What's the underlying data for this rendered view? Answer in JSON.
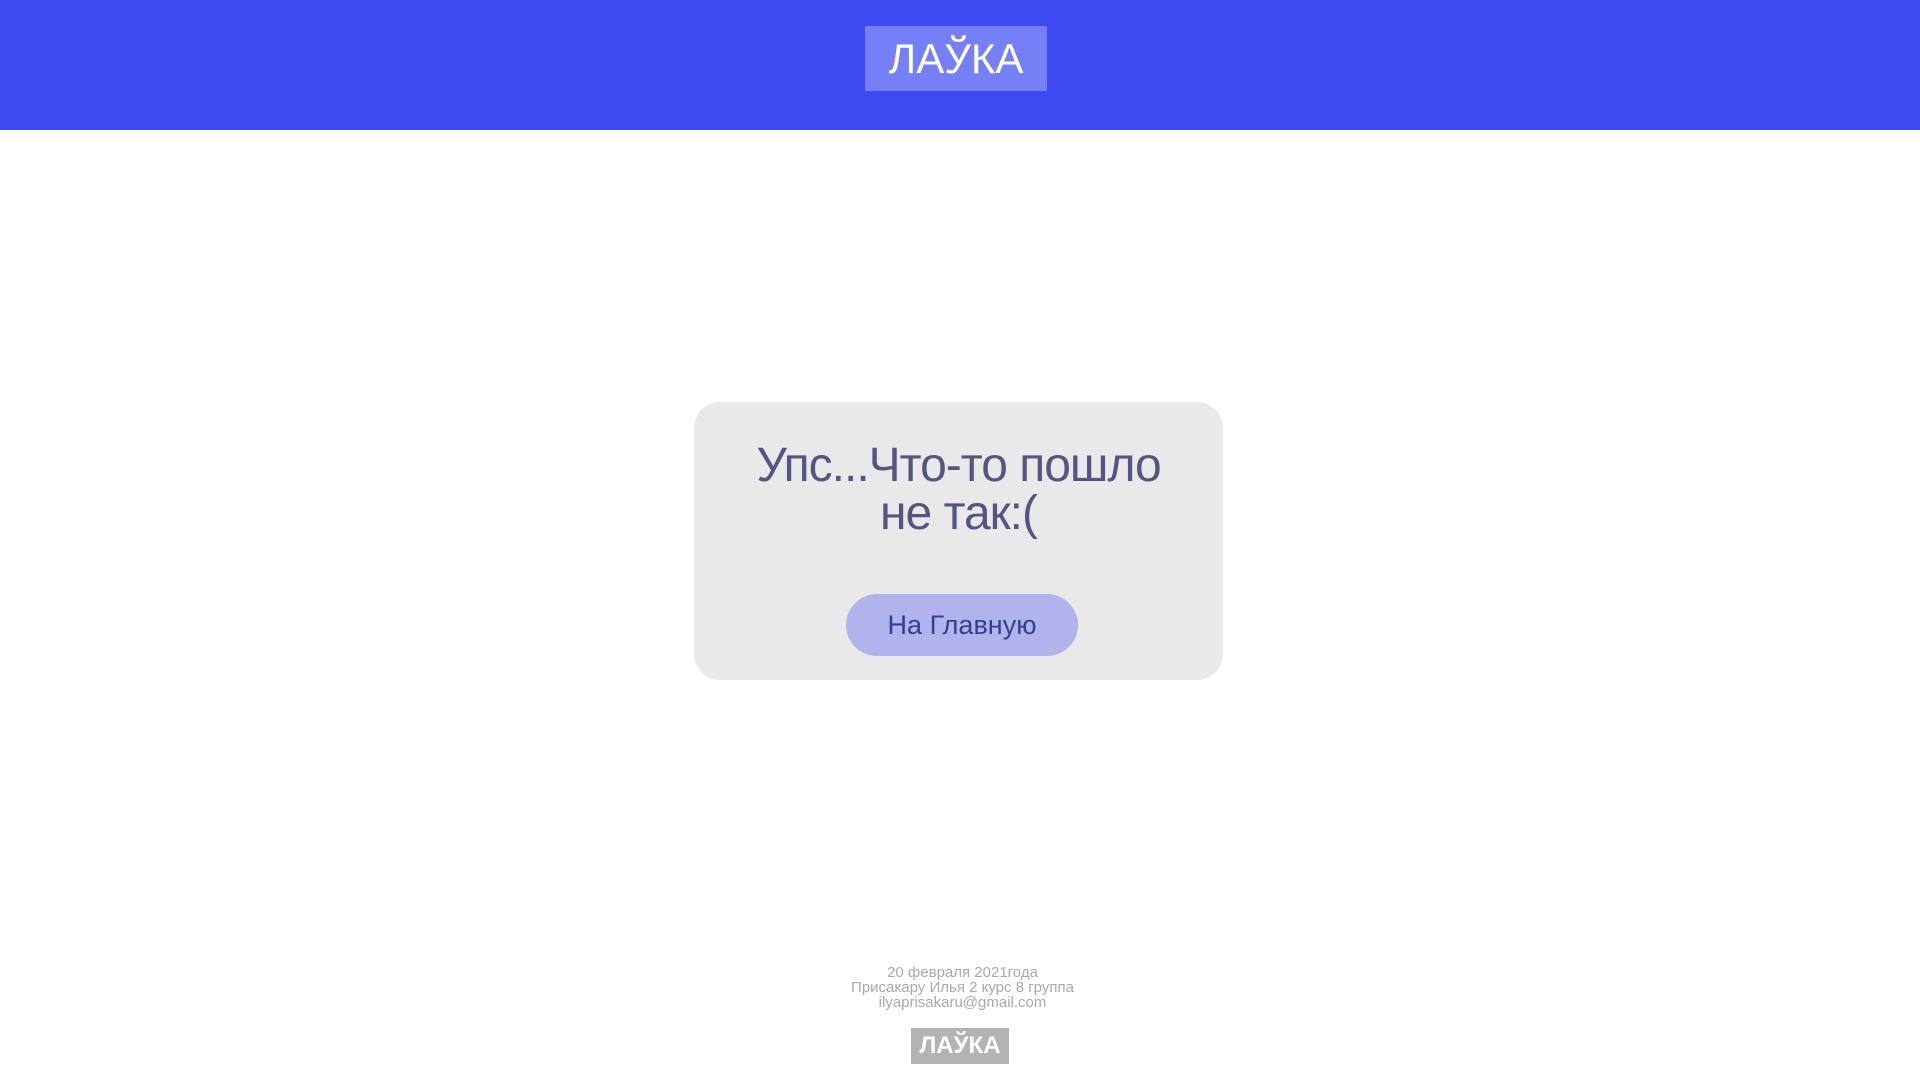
{
  "header": {
    "logo_text": "ЛАЎКА"
  },
  "error": {
    "message_line1": "Упс...Что-то пошло",
    "message_line2": "не так:(",
    "button_label": "На Главную"
  },
  "footer": {
    "date": "20 февраля 2021года",
    "author": "Присакару Илья 2 курс 8 группа",
    "email": "ilyaprisakaru@gmail.com",
    "logo_text": "ЛАЎКА"
  },
  "colors": {
    "header_bg": "#3f49f1",
    "header_logo_bg": "#7680f6",
    "card_bg": "#e9e9e9",
    "message_text": "#555582",
    "button_bg": "#b1b3ec",
    "button_text": "#33408f",
    "footer_text": "#a9a9a9",
    "footer_logo_bg": "#b3b3b3"
  }
}
